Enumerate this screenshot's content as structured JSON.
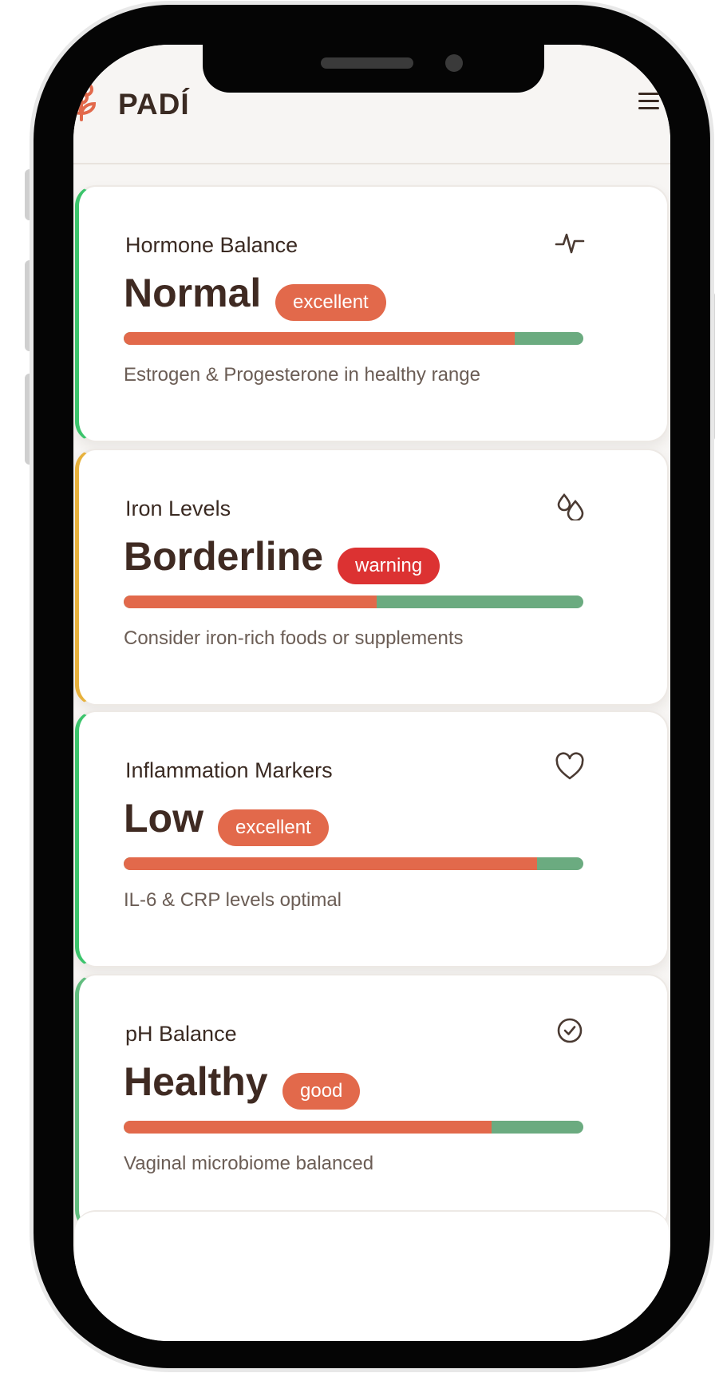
{
  "app": {
    "brand": "PADÍ",
    "logo_icon": "flower-logo-icon",
    "menu_icon": "hamburger-menu-icon"
  },
  "colors": {
    "accent": "#e2694b",
    "bar_remainder": "#6bab80",
    "warning_badge": "#dc3232",
    "border_green": "#3cc46c",
    "border_yellow": "#e7b13c",
    "border_softgreen": "#62bd7f"
  },
  "cards": [
    {
      "title": "Hormone Balance",
      "value": "Normal",
      "badge": "excellent",
      "badge_color": "#e2694b",
      "border_color": "#3cc46c",
      "progress": 0.85,
      "description": "Estrogen & Progesterone in healthy range",
      "icon": "activity-pulse-icon"
    },
    {
      "title": "Iron Levels",
      "value": "Borderline",
      "badge": "warning",
      "badge_color": "#dc3232",
      "border_color": "#e7b13c",
      "progress": 0.55,
      "description": "Consider iron-rich foods or supplements",
      "icon": "droplets-icon"
    },
    {
      "title": "Inflammation Markers",
      "value": "Low",
      "badge": "excellent",
      "badge_color": "#e2694b",
      "border_color": "#3cc46c",
      "progress": 0.9,
      "description": "IL-6 & CRP levels optimal",
      "icon": "heart-icon"
    },
    {
      "title": "pH Balance",
      "value": "Healthy",
      "badge": "good",
      "badge_color": "#e2694b",
      "border_color": "#62bd7f",
      "progress": 0.8,
      "description": "Vaginal microbiome balanced",
      "icon": "check-circle-icon"
    }
  ]
}
